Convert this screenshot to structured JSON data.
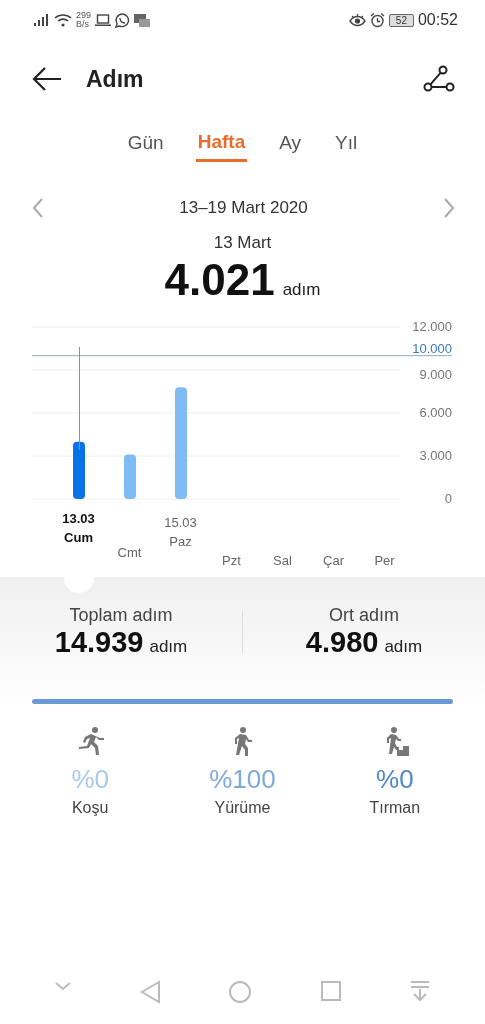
{
  "status_bar": {
    "net_speed_value": "299",
    "net_speed_unit": "B/s",
    "battery": "52",
    "time": "00:52"
  },
  "header": {
    "title": "Adım"
  },
  "tabs": [
    {
      "label": "Gün",
      "selected": false
    },
    {
      "label": "Hafta",
      "selected": true
    },
    {
      "label": "Ay",
      "selected": false
    },
    {
      "label": "Yıl",
      "selected": false
    }
  ],
  "range": {
    "label": "13–19 Mart 2020"
  },
  "day_summary": {
    "date": "13 Mart",
    "value": "4.021",
    "unit": "adım"
  },
  "chart": {
    "chart_data": {
      "type": "bar",
      "series": [
        {
          "color": "#0a72e8",
          "values": [
            4.0,
            null,
            null,
            null,
            null,
            null,
            null
          ]
        },
        {
          "color": "#7fbcf5",
          "values": [
            null,
            3.1,
            7.8,
            null,
            null,
            null,
            null
          ]
        }
      ],
      "grid": true,
      "ylim": [
        0,
        12
      ],
      "yticks": [
        {
          "value": 0,
          "label": "0"
        },
        {
          "value": 3,
          "label": "3.000"
        },
        {
          "value": 6,
          "label": "6.000"
        },
        {
          "value": 9,
          "label": "9.000"
        },
        {
          "value": 12,
          "label": "12.000"
        }
      ],
      "ref_lines": [
        {
          "axis": "y",
          "value": 10,
          "label": "10.000"
        }
      ]
    },
    "day_marks": [
      {
        "selected": true,
        "date": "13.03",
        "day": "Cum"
      },
      {
        "selected": false,
        "day": "Cmt"
      },
      {
        "selected": false,
        "date": "15.03",
        "day": "Paz"
      },
      {
        "selected": false,
        "day": "Pzt"
      },
      {
        "selected": false,
        "day": "Sal"
      },
      {
        "selected": false,
        "day": "Çar"
      },
      {
        "selected": false,
        "day": "Per"
      }
    ]
  },
  "totals": [
    {
      "label": "Toplam adım",
      "value": "14.939",
      "unit": "adım"
    },
    {
      "label": "Ort adım",
      "value": "4.980",
      "unit": "adım"
    }
  ],
  "activities": [
    {
      "kind": "run",
      "percent": "%0",
      "label": "Koşu",
      "color": "#a9c9ec"
    },
    {
      "kind": "walk",
      "percent": "%100",
      "label": "Yürüme",
      "color": "#7fa9da"
    },
    {
      "kind": "climb",
      "percent": "%0",
      "label": "Tırman",
      "color": "#4f87cc"
    }
  ]
}
